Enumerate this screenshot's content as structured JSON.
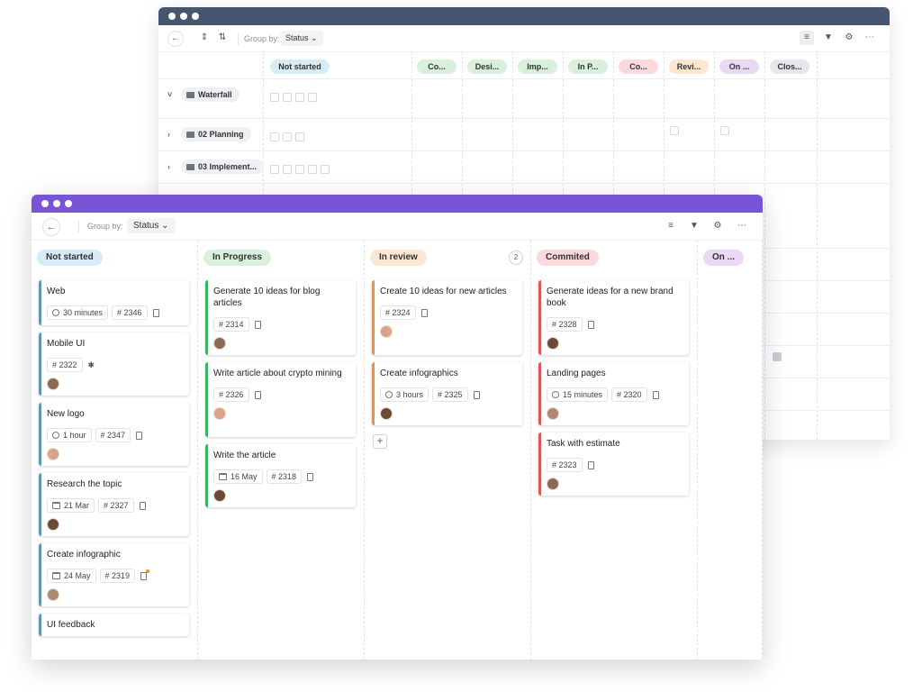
{
  "back_window": {
    "group_by_label": "Group by:",
    "group_by_value": "Status",
    "statuses": [
      {
        "label": "Not started",
        "color": "#d6ecf7"
      },
      {
        "label": "Co...",
        "color": "#d9f0dc"
      },
      {
        "label": "Desi...",
        "color": "#d9f0dc"
      },
      {
        "label": "Imp...",
        "color": "#d9f0dc"
      },
      {
        "label": "In P...",
        "color": "#d9f0dc"
      },
      {
        "label": "Co...",
        "color": "#fbd9dd"
      },
      {
        "label": "Revi...",
        "color": "#fde6d2"
      },
      {
        "label": "On ...",
        "color": "#ead9f5"
      },
      {
        "label": "Clos...",
        "color": "#e5e7ea"
      }
    ],
    "groups": [
      {
        "label": "Waterfall",
        "expanded": true
      },
      {
        "label": "02 Planning",
        "expanded": false
      },
      {
        "label": "03 Implement...",
        "expanded": false
      }
    ]
  },
  "front_window": {
    "group_by_label": "Group by:",
    "group_by_value": "Status",
    "columns": [
      {
        "title": "Not started",
        "color": "#d6ecf7",
        "border": "#3aa6d8",
        "count": "",
        "cards": [
          {
            "title": "Web",
            "meta": [
              {
                "icon": "clock-icon",
                "text": "30 minutes"
              },
              {
                "icon": "",
                "text": "# 2346"
              }
            ],
            "clip": true,
            "avatar": false
          },
          {
            "title": "Mobile UI",
            "meta": [
              {
                "icon": "",
                "text": "# 2322"
              }
            ],
            "bug": true,
            "clip": false,
            "avatar": true
          },
          {
            "title": "New logo",
            "meta": [
              {
                "icon": "clock-icon",
                "text": "1 hour"
              },
              {
                "icon": "",
                "text": "# 2347"
              }
            ],
            "clip": true,
            "avatar": true
          },
          {
            "title": "Research the topic",
            "meta": [
              {
                "icon": "calendar-icon",
                "text": "21 Mar"
              },
              {
                "icon": "",
                "text": "# 2327"
              }
            ],
            "clip": true,
            "avatar": true
          },
          {
            "title": "Create infographic",
            "meta": [
              {
                "icon": "calendar-icon",
                "text": "24 May"
              },
              {
                "icon": "",
                "text": "# 2319"
              }
            ],
            "clip": true,
            "clip_dot": true,
            "avatar": true
          },
          {
            "title": "UI feedback",
            "meta": [],
            "clip": false,
            "avatar": false
          }
        ]
      },
      {
        "title": "In Progress",
        "color": "#d9f0dc",
        "border": "#3db163",
        "count": "",
        "cards": [
          {
            "title": "Generate 10 ideas for blog articles",
            "meta": [
              {
                "icon": "",
                "text": "# 2314"
              }
            ],
            "clip": true,
            "avatar": true
          },
          {
            "title": "Write article about crypto mining",
            "meta": [
              {
                "icon": "",
                "text": "# 2326"
              }
            ],
            "clip": true,
            "avatar": true
          },
          {
            "title": "Write the article",
            "meta": [
              {
                "icon": "calendar-icon",
                "text": "16 May"
              },
              {
                "icon": "",
                "text": "# 2318"
              }
            ],
            "clip": true,
            "avatar": true
          }
        ]
      },
      {
        "title": "In review",
        "color": "#fde6d2",
        "border": "#f0913a",
        "count": "2",
        "cards": [
          {
            "title": "Create 10 ideas for new articles",
            "meta": [
              {
                "icon": "",
                "text": "# 2324"
              }
            ],
            "clip": true,
            "avatar": true
          },
          {
            "title": "Create infographics",
            "meta": [
              {
                "icon": "clock-icon",
                "text": "3 hours"
              },
              {
                "icon": "",
                "text": "# 2325"
              }
            ],
            "clip": true,
            "avatar": true
          }
        ]
      },
      {
        "title": "Commited",
        "color": "#fbd9dd",
        "border": "#e0535f",
        "count": "",
        "cards": [
          {
            "title": "Generate ideas for a new brand book",
            "meta": [
              {
                "icon": "",
                "text": "# 2328"
              }
            ],
            "clip": true,
            "avatar": true
          },
          {
            "title": "Landing pages",
            "meta": [
              {
                "icon": "clock-icon",
                "text": "15 minutes"
              },
              {
                "icon": "",
                "text": "# 2320"
              }
            ],
            "clip": true,
            "avatar": true
          },
          {
            "title": "Task with estimate",
            "meta": [
              {
                "icon": "",
                "text": "# 2323"
              }
            ],
            "clip": true,
            "avatar": true
          }
        ]
      },
      {
        "title": "On ...",
        "color": "#ead9f5",
        "border": "#9b6ad6",
        "count": "",
        "cards": []
      }
    ]
  }
}
